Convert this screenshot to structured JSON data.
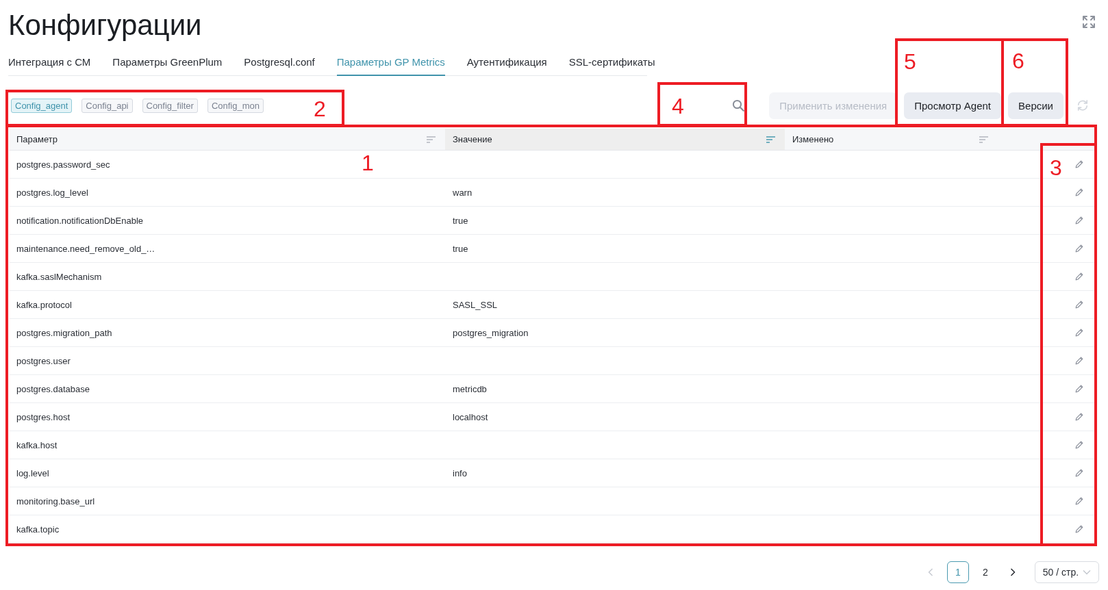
{
  "page": {
    "title": "Конфигурации"
  },
  "tabs": [
    {
      "label": "Интеграция с СМ",
      "selected": false
    },
    {
      "label": "Параметры GreenPlum",
      "selected": false
    },
    {
      "label": "Postgresql.conf",
      "selected": false
    },
    {
      "label": "Параметры GP Metrics",
      "selected": true
    },
    {
      "label": "Аутентификация",
      "selected": false
    },
    {
      "label": "SSL-сертификаты",
      "selected": false
    }
  ],
  "toolbar": {
    "config_tags": [
      {
        "label": "Config_agent",
        "selected": true
      },
      {
        "label": "Config_api",
        "selected": false
      },
      {
        "label": "Config_filter",
        "selected": false
      },
      {
        "label": "Config_mon",
        "selected": false
      }
    ],
    "buttons": [
      {
        "label": "Применить изменения",
        "disabled": true
      },
      {
        "label": "Просмотр Agent",
        "disabled": false
      },
      {
        "label": "Версии",
        "disabled": false
      }
    ]
  },
  "table": {
    "columns": [
      {
        "label": "Параметр",
        "sorted": false
      },
      {
        "label": "Значение",
        "sorted": true
      },
      {
        "label": "Изменено",
        "sorted": false
      }
    ],
    "rows": [
      {
        "parameter": "postgres.password_sec"
      },
      {
        "parameter": "postgres.log_level",
        "value": "warn"
      },
      {
        "parameter": "notification.notificationDbEnable",
        "value": "true"
      },
      {
        "parameter": "maintenance.need_remove_old_…",
        "value": "true"
      },
      {
        "parameter": "kafka.saslMechanism"
      },
      {
        "parameter": "kafka.protocol",
        "value": "SASL_SSL"
      },
      {
        "parameter": "postgres.migration_path",
        "value": "postgres_migration"
      },
      {
        "parameter": "postgres.user"
      },
      {
        "parameter": "postgres.database",
        "value": "metricdb"
      },
      {
        "parameter": "postgres.host",
        "value": "localhost"
      },
      {
        "parameter": "kafka.host"
      },
      {
        "parameter": "log.level",
        "value": "info"
      },
      {
        "parameter": "monitoring.base_url"
      },
      {
        "parameter": "kafka.topic"
      }
    ]
  },
  "pagination": {
    "previous": {
      "disabled": true
    },
    "pages": [
      {
        "label": "1",
        "selected": true
      },
      {
        "label": "2",
        "selected": false
      }
    ],
    "next": {
      "disabled": false
    },
    "page_size": "50 / стр."
  },
  "annotations": [
    {
      "label": "1"
    },
    {
      "label": "2"
    },
    {
      "label": "3"
    },
    {
      "label": "4"
    },
    {
      "label": "5"
    },
    {
      "label": "6"
    }
  ]
}
